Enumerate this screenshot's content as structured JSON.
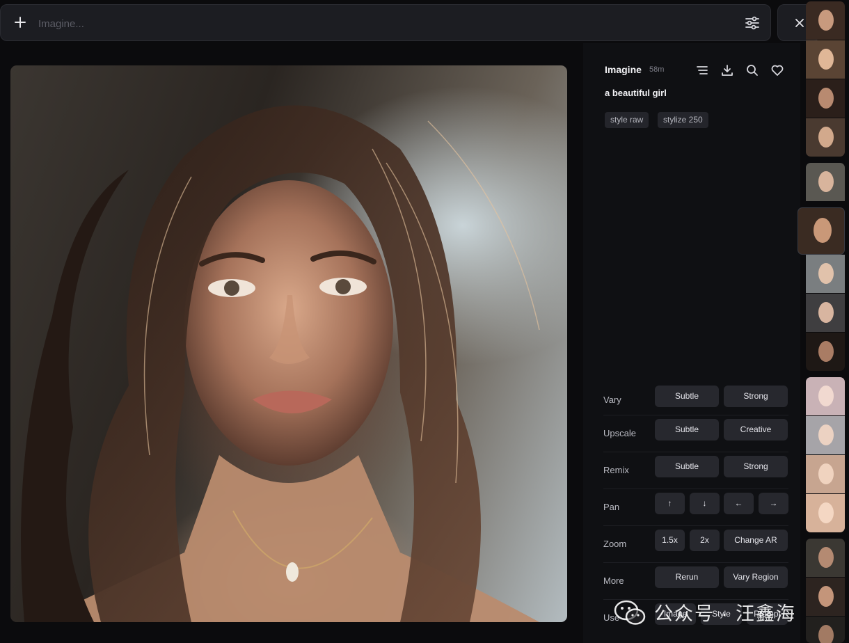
{
  "prompt_bar": {
    "placeholder": "Imagine...",
    "add_icon": "plus-icon",
    "settings_icon": "sliders-icon"
  },
  "close_icon": "close-icon",
  "info": {
    "mode": "Imagine",
    "time": "58m",
    "icons": [
      "list-icon",
      "download-icon",
      "search-icon",
      "heart-icon"
    ],
    "prompt": "a beautiful girl",
    "tags": [
      "style raw",
      "stylize 250"
    ]
  },
  "actions": [
    {
      "label": "Vary",
      "buttons": [
        "Subtle",
        "Strong"
      ]
    },
    {
      "label": "Upscale",
      "buttons": [
        "Subtle",
        "Creative"
      ]
    },
    {
      "label": "Remix",
      "buttons": [
        "Subtle",
        "Strong"
      ]
    },
    {
      "label": "Pan",
      "buttons": [
        "↑",
        "↓",
        "←",
        "→"
      ]
    },
    {
      "label": "Zoom",
      "buttons": [
        "1.5x",
        "2x",
        "Change AR"
      ]
    },
    {
      "label": "More",
      "buttons": [
        "Rerun",
        "Vary Region"
      ]
    },
    {
      "label": "Use",
      "buttons": [
        "Image",
        "Style",
        "Prompt"
      ]
    }
  ],
  "watermark": {
    "logo": "wechat-icon",
    "text": "公众号 · 汪鑫海"
  },
  "colors": {
    "background": "#0b0b0d",
    "panel": "#0f1013",
    "button": "#27282e",
    "tag": "#24252b"
  }
}
